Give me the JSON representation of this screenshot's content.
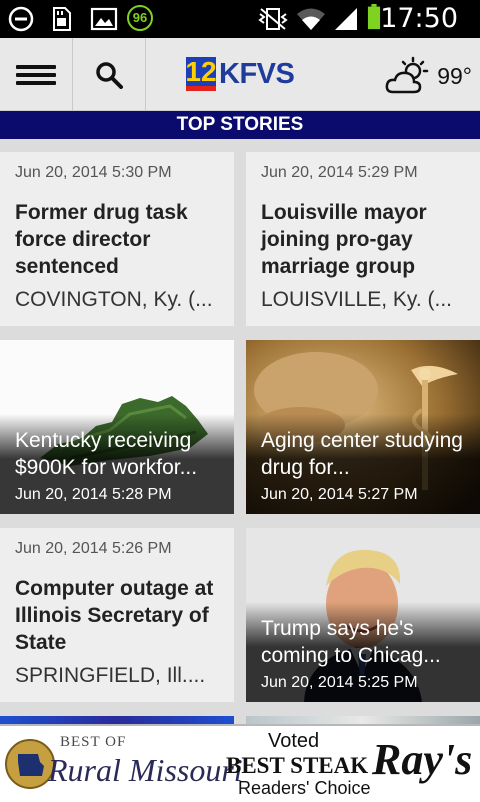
{
  "status_bar": {
    "time": "17:50",
    "notification_badge": "96"
  },
  "app_bar": {
    "logo_number": "12",
    "logo_text": "KFVS",
    "temperature": "99°"
  },
  "section": {
    "title": "TOP STORIES"
  },
  "stories": [
    {
      "date": "Jun 20, 2014 5:30 PM",
      "headline": "Former drug task force director sentenced",
      "excerpt": "COVINGTON, Ky. (..."
    },
    {
      "date": "Jun 20, 2014 5:29 PM",
      "headline": "Louisville mayor joining pro-gay marriage group",
      "excerpt": "LOUISVILLE, Ky. (..."
    },
    {
      "date": "Jun 20, 2014 5:28 PM",
      "headline": "Kentucky receiving $900K for workfor..."
    },
    {
      "date": "Jun 20, 2014 5:27 PM",
      "headline": "Aging center studying drug for..."
    },
    {
      "date": "Jun 20, 2014 5:26 PM",
      "headline": "Computer outage at Illinois Secretary of State",
      "excerpt": "SPRINGFIELD, Ill...."
    },
    {
      "date": "Jun 20, 2014 5:25 PM",
      "headline": "Trump says he's coming to Chicag..."
    }
  ],
  "ad": {
    "best_of": "BEST OF",
    "rural_missouri": "Rural Missouri",
    "voted": "Voted",
    "best_steak": "BEST STEAK",
    "readers_choice": "Readers' Choice",
    "brand": "Ray's"
  },
  "colors": {
    "section_bg": "#0b0b6e",
    "logo_blue": "#1b3fb8",
    "logo_yellow": "#ffd000",
    "logo_red": "#e2231a",
    "battery_green": "#7ed321"
  },
  "icons": [
    "block-icon",
    "sd-card-icon",
    "image-icon",
    "badge-96-icon",
    "vibrate-icon",
    "wifi-icon",
    "signal-icon",
    "battery-icon",
    "menu-icon",
    "search-icon",
    "partly-cloudy-icon"
  ]
}
